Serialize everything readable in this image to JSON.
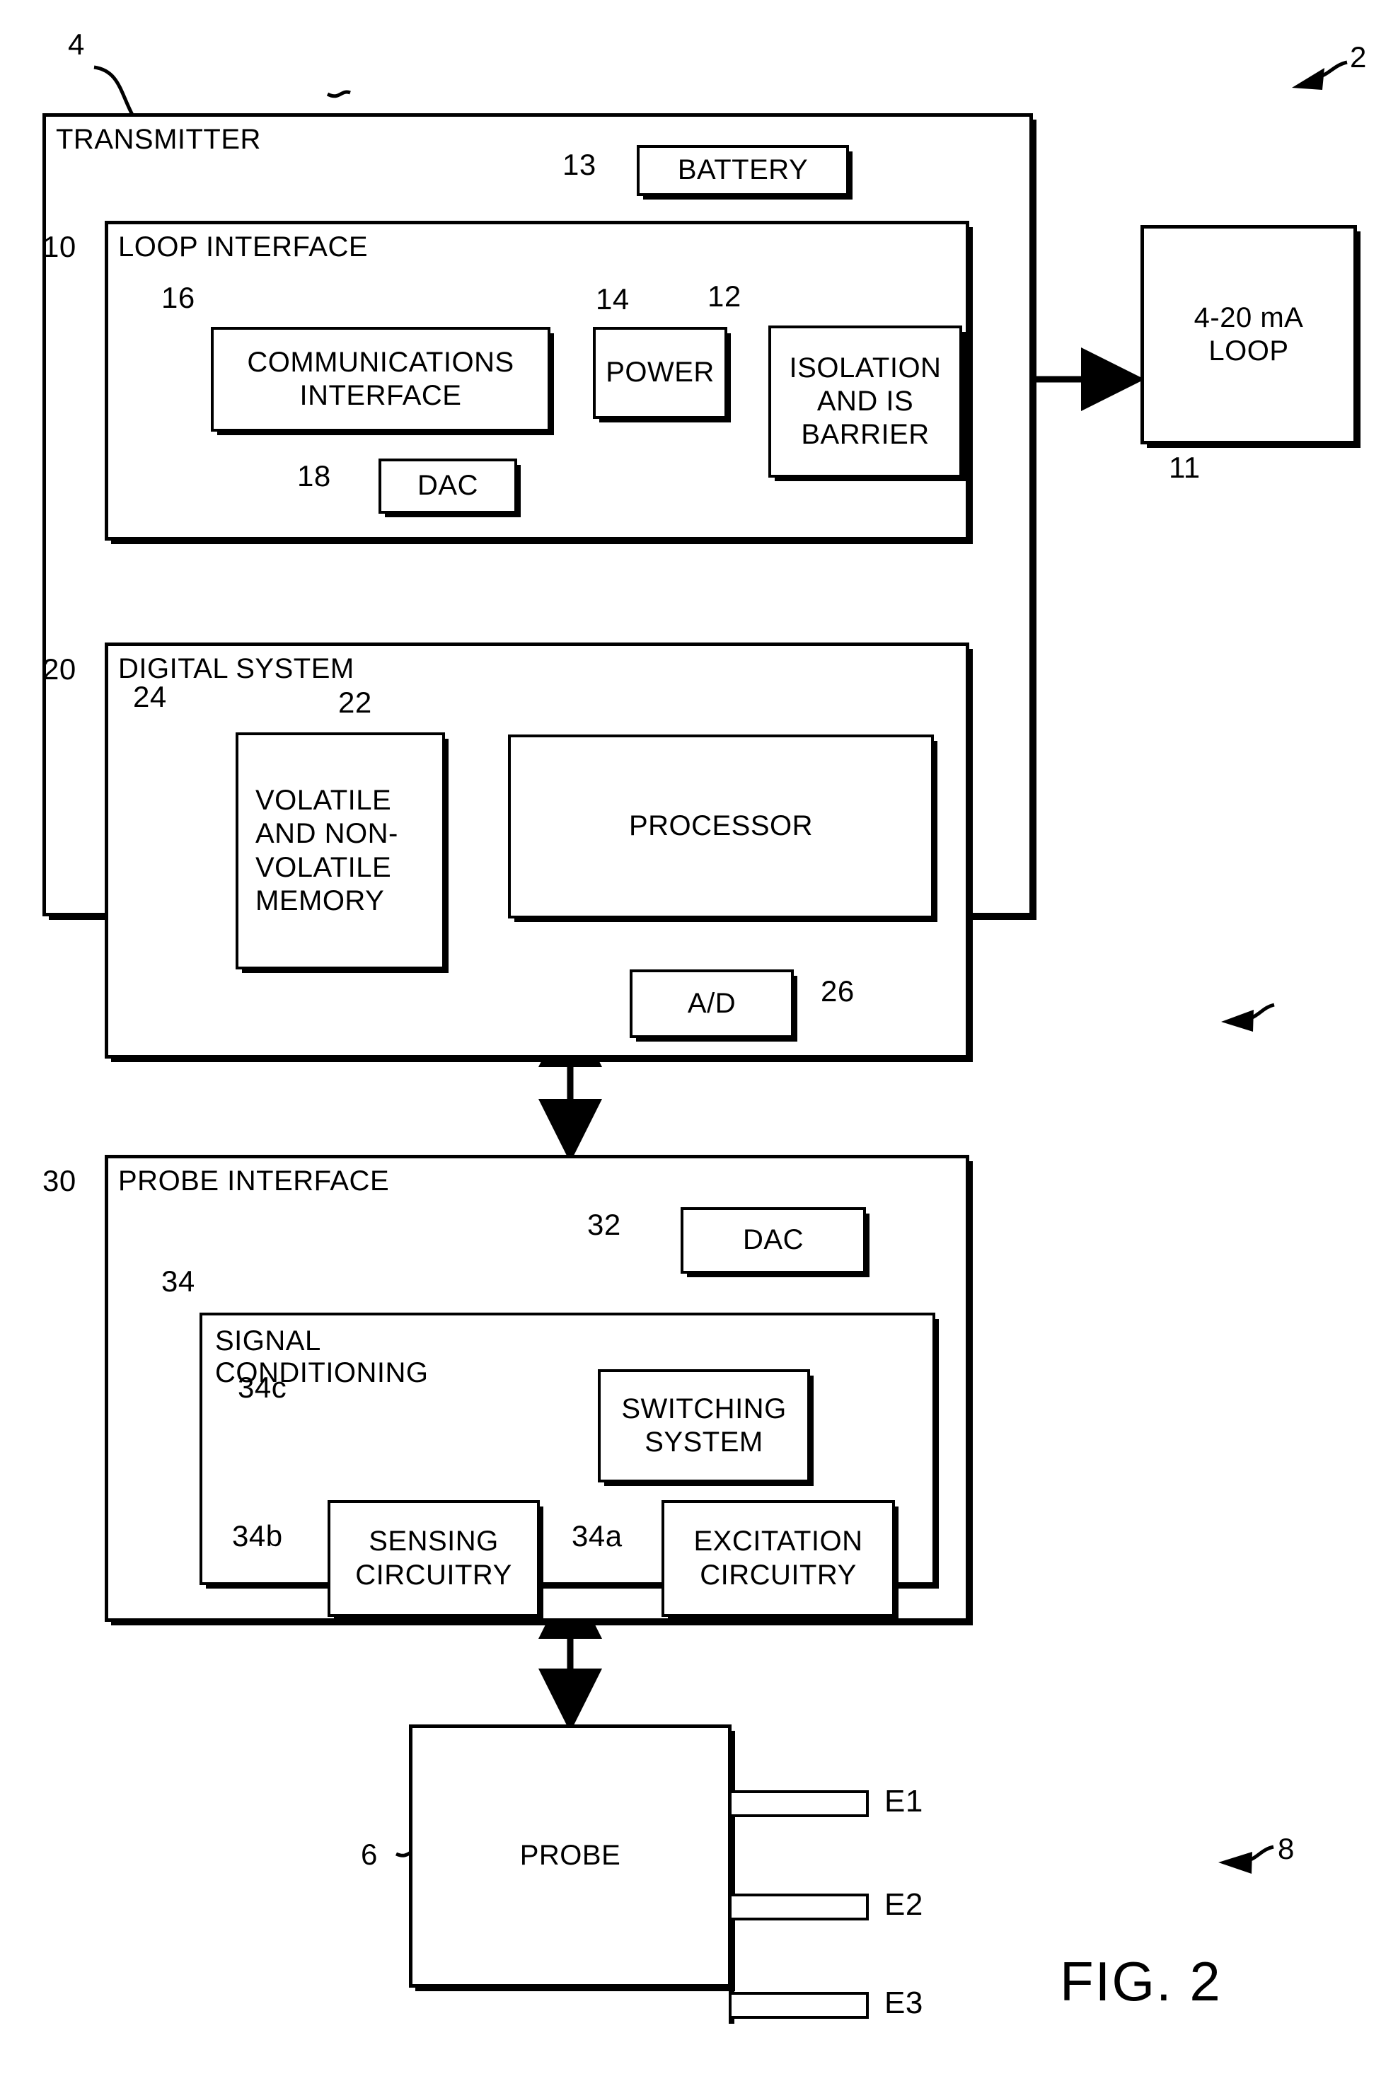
{
  "figure": {
    "caption": "FIG. 2",
    "system_ref": "2",
    "probe_assembly_ref": "8"
  },
  "transmitter": {
    "ref": "4",
    "label": "TRANSMITTER"
  },
  "battery": {
    "ref": "13",
    "label": "BATTERY"
  },
  "loop_interface": {
    "ref": "10",
    "label": "LOOP INTERFACE",
    "communications_interface": {
      "ref": "16",
      "label": "COMMUNICATIONS\nINTERFACE"
    },
    "power": {
      "ref": "14",
      "label": "POWER"
    },
    "isolation": {
      "ref": "12",
      "label": "ISOLATION\nAND IS\nBARRIER"
    },
    "dac": {
      "ref": "18",
      "label": "DAC"
    }
  },
  "loop": {
    "ref": "11",
    "label": "4-20 mA\nLOOP"
  },
  "digital_system": {
    "ref": "20",
    "label": "DIGITAL SYSTEM",
    "memory": {
      "ref": "24",
      "label": "VOLATILE\nAND NON-\nVOLATILE\nMEMORY"
    },
    "processor": {
      "ref": "22",
      "label": "PROCESSOR"
    },
    "ad_converter": {
      "ref": "26",
      "label": "A/D"
    }
  },
  "probe_interface": {
    "ref": "30",
    "label": "PROBE INTERFACE",
    "dac": {
      "ref": "32",
      "label": "DAC"
    },
    "signal_conditioning": {
      "ref": "34",
      "label": "SIGNAL\nCONDITIONING",
      "switching_system": {
        "ref": "34c",
        "label": "SWITCHING\nSYSTEM"
      },
      "sensing_circuitry": {
        "ref": "34b",
        "label": "SENSING\nCIRCUITRY"
      },
      "excitation_circuitry": {
        "ref": "34a",
        "label": "EXCITATION\nCIRCUITRY"
      }
    }
  },
  "probe": {
    "ref": "6",
    "label": "PROBE",
    "electrodes": [
      {
        "label": "E1"
      },
      {
        "label": "E2"
      },
      {
        "label": "E3"
      }
    ]
  },
  "colors": {
    "ink": "#000000",
    "paper": "#ffffff"
  }
}
